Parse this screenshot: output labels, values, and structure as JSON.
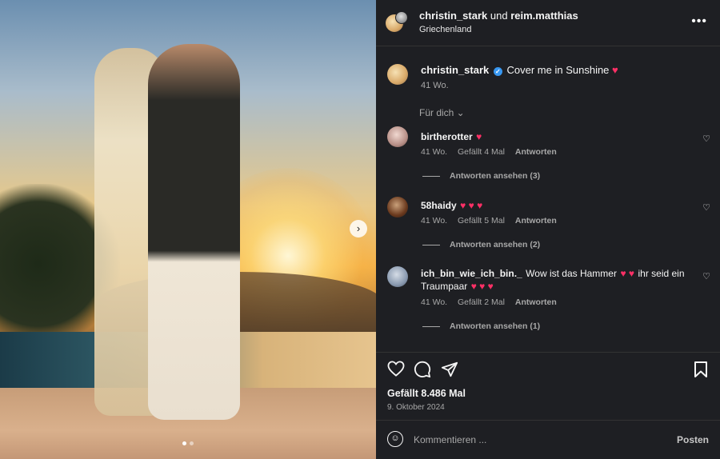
{
  "post": {
    "header": {
      "user1": "christin_stark",
      "connector": "und",
      "user2": "reim.matthias",
      "location": "Griechenland",
      "more_icon": "more-horizontal-icon"
    },
    "caption": {
      "username": "christin_stark",
      "verified": true,
      "text": "Cover me in Sunshine",
      "emoji": "♥",
      "time": "41 Wo."
    },
    "filter_label": "Für dich ⌄",
    "comments": [
      {
        "username": "birtherotter",
        "text": "",
        "emoji": "♥",
        "time": "41 Wo.",
        "likes": "Gefällt 4 Mal",
        "reply": "Antworten",
        "replies": "Antworten ansehen (3)"
      },
      {
        "username": "58haidy",
        "text": "",
        "emoji": "♥ ♥ ♥",
        "time": "41 Wo.",
        "likes": "Gefällt 5 Mal",
        "reply": "Antworten",
        "replies": "Antworten ansehen (2)"
      },
      {
        "username": "ich_bin_wie_ich_bin._",
        "text": "Wow ist das Hammer",
        "emoji": "♥ ♥",
        "text2": "ihr seid ein",
        "text3": "Traumpaar",
        "emoji2": "♥ ♥ ♥",
        "time": "41 Wo.",
        "likes": "Gefällt 2 Mal",
        "reply": "Antworten",
        "replies": "Antworten ansehen (1)"
      }
    ],
    "likes": "Gefällt 8.486 Mal",
    "date": "9. Oktober 2024",
    "composer": {
      "placeholder": "Kommentieren ...",
      "post_label": "Posten"
    },
    "carousel": {
      "current": 1,
      "total": 2
    }
  },
  "icons": {
    "like": "heart-icon",
    "comment": "comment-icon",
    "share": "paper-plane-icon",
    "save": "bookmark-icon",
    "emoji": "smiley-icon",
    "next": "chevron-right-icon"
  }
}
